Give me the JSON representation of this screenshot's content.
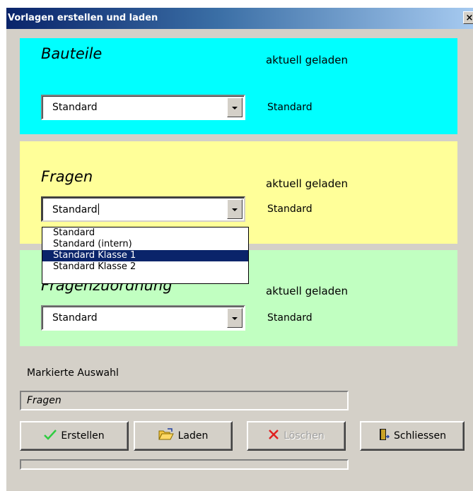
{
  "window": {
    "title": "Vorlagen erstellen und laden",
    "close_glyph": "×"
  },
  "sections": [
    {
      "heading": "Bauteile",
      "loaded_label": "aktuell geladen",
      "loaded_value": "Standard",
      "combo_value": "Standard",
      "color": "#00ffff"
    },
    {
      "heading": "Fragen",
      "loaded_label": "aktuell geladen",
      "loaded_value": "Standard",
      "combo_value": "Standard",
      "color": "#ffff99"
    },
    {
      "heading": "Fragenzuordnung",
      "loaded_label": "aktuell geladen",
      "loaded_value": "Standard",
      "combo_value": "Standard",
      "color": "#c1ffc1"
    }
  ],
  "dropdown": {
    "options": [
      "Standard",
      "Standard (intern)",
      "Standard Klasse 1",
      "Standard Klasse 2"
    ],
    "highlighted": "Standard Klasse 1"
  },
  "selection": {
    "label": "Markierte Auswahl",
    "value": "Fragen"
  },
  "buttons": {
    "create": {
      "label": "Erstellen",
      "icon": "checkmark-icon"
    },
    "load": {
      "label": "Laden",
      "icon": "open-folder-icon"
    },
    "delete": {
      "label": "Löschen",
      "icon": "delete-x-icon",
      "disabled": true
    },
    "close": {
      "label": "Schliessen",
      "icon": "exit-door-icon"
    }
  }
}
